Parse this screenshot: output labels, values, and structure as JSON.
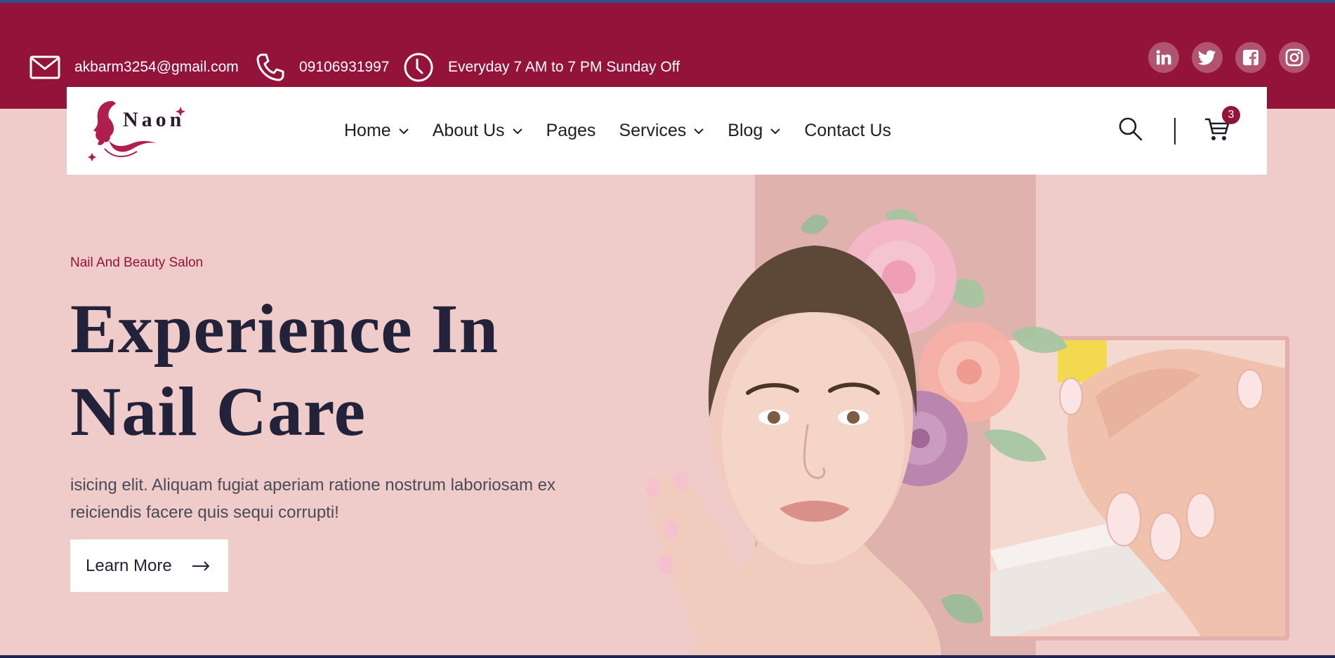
{
  "topbar": {
    "email": "akbarm3254@gmail.com",
    "phone": "09106931997",
    "hours": "Everyday 7 AM to 7 PM Sunday Off",
    "social": [
      "linkedin-icon",
      "twitter-icon",
      "facebook-icon",
      "instagram-icon"
    ]
  },
  "brand": {
    "logo_text": "Naon"
  },
  "nav": {
    "items": [
      {
        "label": "Home",
        "dropdown": true
      },
      {
        "label": "About Us",
        "dropdown": true
      },
      {
        "label": "Pages",
        "dropdown": false
      },
      {
        "label": "Services",
        "dropdown": true
      },
      {
        "label": "Blog",
        "dropdown": true
      },
      {
        "label": "Contact Us",
        "dropdown": false
      }
    ],
    "cart_count": "3"
  },
  "hero": {
    "subtitle": "Nail And Beauty Salon",
    "title_line1": "Experience In",
    "title_line2": "Nail Care",
    "text": "isicing elit. Aliquam fugiat aperiam ratione nostrum laboriosam ex reiciendis facere quis sequi corrupti!",
    "cta_label": "Learn More"
  },
  "colors": {
    "primary": "#94133b",
    "background": "#efcbc9",
    "heading": "#22223a"
  }
}
